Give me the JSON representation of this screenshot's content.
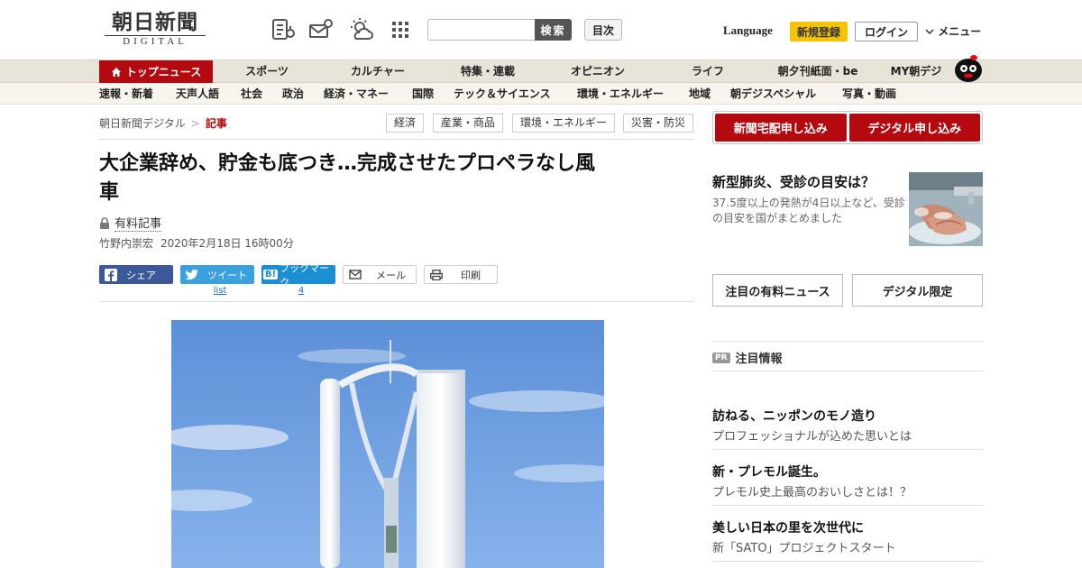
{
  "header": {
    "logo_ja": "朝日新聞",
    "logo_en": "DIGITAL",
    "search_placeholder": "",
    "search_button": "検索",
    "mokuji_button": "目次",
    "language": "Language",
    "register_button": "新規登録",
    "login_button": "ログイン",
    "menu_button": "メニュー"
  },
  "nav_primary": {
    "home": "トップニュース",
    "items": [
      "スポーツ",
      "カルチャー",
      "特集・連載",
      "オピニオン",
      "ライフ",
      "朝夕刊紙面・be",
      "MY朝デジ"
    ]
  },
  "nav_secondary": {
    "items": [
      "速報・新着",
      "天声人語",
      "社会",
      "政治",
      "経済・マネー",
      "国際",
      "テック＆サイエンス",
      "環境・エネルギー",
      "地域",
      "朝デジスペシャル",
      "写真・動画"
    ]
  },
  "breadcrumb": {
    "root": "朝日新聞デジタル",
    "separator": ">",
    "current": "記事"
  },
  "tags": [
    "経済",
    "産業・商品",
    "環境・エネルギー",
    "災害・防災"
  ],
  "article": {
    "headline_line1": "大企業辞め、貯金も底つき…完成させたプロペラなし風",
    "headline_line2": "車",
    "paid_label": "有料記事",
    "author": "竹野内崇宏",
    "date": "2020年2月18日 16時00分"
  },
  "share": {
    "facebook": "シェア",
    "twitter": "ツイート",
    "hatena_logo": "B!",
    "hatena": "ブックマーク",
    "mail": "メール",
    "print": "印刷",
    "twitter_count": "list",
    "hatena_count": "4"
  },
  "sidebar": {
    "subscribe_paper": "新聞宅配申し込み",
    "subscribe_digital": "デジタル申し込み",
    "feature_title": "新型肺炎、受診の目安は？",
    "feature_desc": "37.5度以上の発熱が4日以上など、受診の目安を国がまとめました",
    "tab_paid": "注目の有料ニュース",
    "tab_digital": "デジタル限定",
    "pr_badge": "PR",
    "pr_heading": "注目情報",
    "pr_items": [
      {
        "title": "訪ねる、ニッポンのモノ造り",
        "desc": "プロフェッショナルが込めた思いとは"
      },
      {
        "title": "新・プレモル誕生。",
        "desc": "プレモル史上最高のおいしさとは！？"
      },
      {
        "title": "美しい日本の里を次世代に",
        "desc": "新「SATO」プロジェクトスタート"
      }
    ]
  },
  "colors": {
    "brand_red": "#b4090f",
    "register_yellow": "#f4c400",
    "facebook": "#3b5998",
    "twitter": "#3aa1de",
    "hatena": "#1b8ed4"
  },
  "icons": [
    "news-list-icon",
    "weather-mail-icon",
    "weather-sun-cloud-icon",
    "app-grid-icon",
    "home-icon",
    "lock-icon",
    "chevron-down-icon",
    "facebook-icon",
    "twitter-icon",
    "mail-icon",
    "print-icon"
  ]
}
